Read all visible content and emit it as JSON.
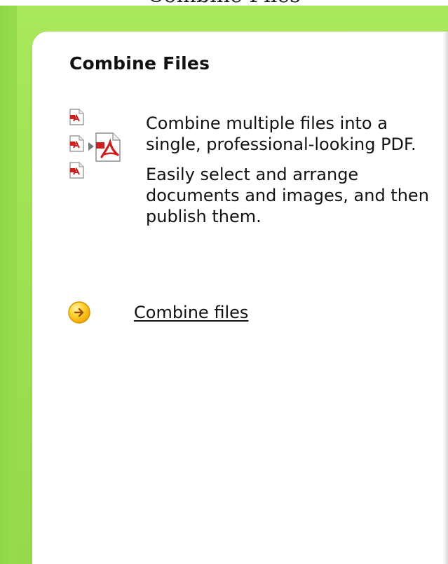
{
  "page": {
    "top_label": "Combine Files"
  },
  "panel": {
    "title": "Combine Files",
    "description_lines": [
      "Combine multiple files into a single, professional-looking PDF.",
      "Easily select and arrange documents and images, and then publish them."
    ],
    "action": {
      "label": "Combine files",
      "icon": "arrow-right-circle-icon"
    },
    "icons": {
      "combine": "combine-files-icon"
    }
  },
  "colors": {
    "background_green": "#9fe252",
    "panel_white": "#ffffff",
    "pdf_red": "#cc1f1f",
    "link_yellow": "#ffc21f"
  }
}
